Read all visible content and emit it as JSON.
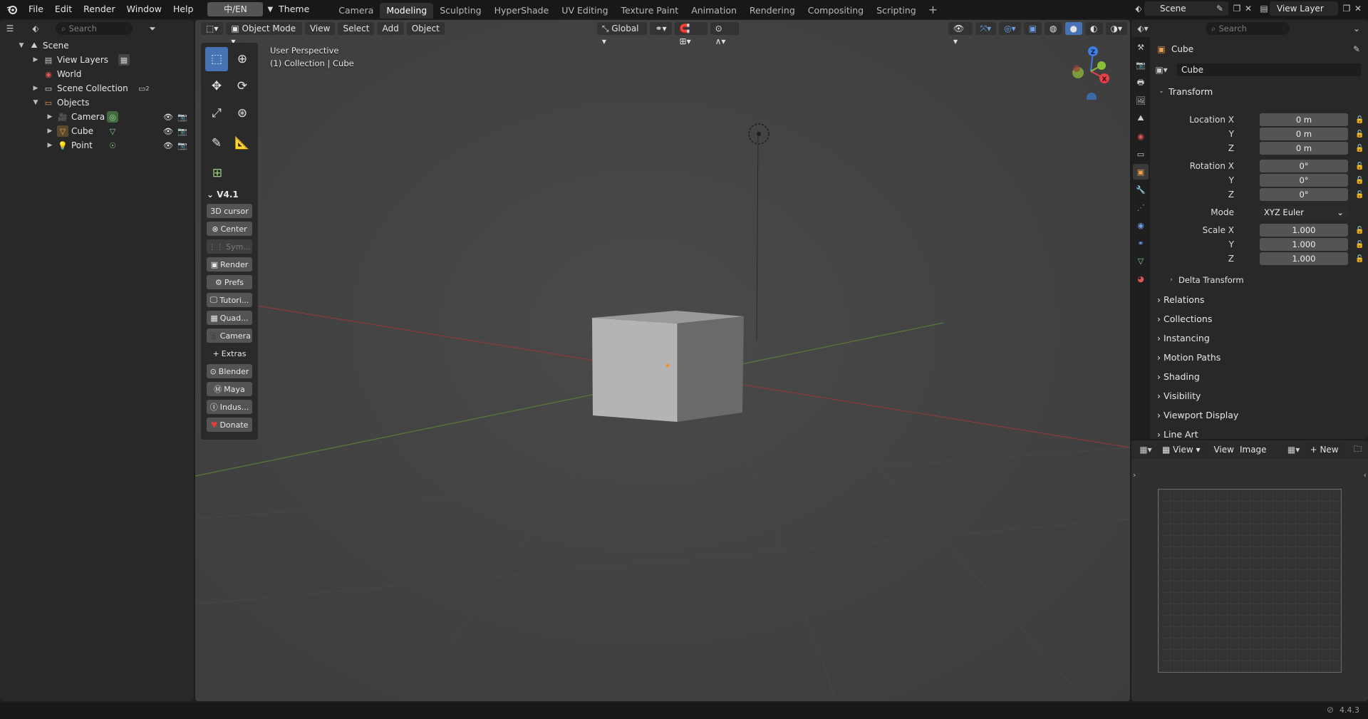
{
  "menu": {
    "items": [
      "File",
      "Edit",
      "Render",
      "Window",
      "Help"
    ],
    "lang_button": "中/EN",
    "theme_label": "Theme"
  },
  "workspaces": {
    "tabs": [
      "Camera",
      "Modeling",
      "Sculpting",
      "HyperShade",
      "UV Editing",
      "Texture Paint",
      "Animation",
      "Rendering",
      "Compositing",
      "Scripting"
    ],
    "active": "Modeling"
  },
  "top_right": {
    "scene": "Scene",
    "view_layer": "View Layer"
  },
  "outliner": {
    "search_placeholder": "Search",
    "rows": {
      "scene": "Scene",
      "view_layers": "View Layers",
      "world": "World",
      "scene_collection": "Scene Collection",
      "scene_collection_badge": "2",
      "objects": "Objects",
      "camera": "Camera",
      "cube": "Cube",
      "point": "Point"
    }
  },
  "viewport": {
    "header": {
      "mode": "Object Mode",
      "view": "View",
      "select": "Select",
      "add": "Add",
      "object": "Object",
      "orientation": "Global"
    },
    "overlay_line1": "User Perspective",
    "overlay_line2": "(1) Collection | Cube",
    "gizmo": {
      "z": "Z",
      "x": "X"
    }
  },
  "v41_panel": {
    "title": "V4.1",
    "buttons": {
      "cursor": "3D cursor",
      "center": "Center",
      "sym": "Sym...",
      "render": "Render",
      "prefs": "Prefs",
      "tutorials": "Tutori...",
      "quad": "Quad...",
      "camera": "Camera",
      "extras": "Extras",
      "blender": "Blender",
      "maya": "Maya",
      "industry": "Indus...",
      "donate": "Donate"
    }
  },
  "properties": {
    "search_placeholder": "Search",
    "object_title": "Cube",
    "object_name": "Cube",
    "transform_title": "Transform",
    "location_label": "Location X",
    "rotation_label": "Rotation X",
    "scale_label": "Scale X",
    "y_label": "Y",
    "z_label": "Z",
    "location": [
      "0 m",
      "0 m",
      "0 m"
    ],
    "rotation": [
      "0°",
      "0°",
      "0°"
    ],
    "mode_label": "Mode",
    "mode_value": "XYZ Euler",
    "scale": [
      "1.000",
      "1.000",
      "1.000"
    ],
    "delta": "Delta Transform",
    "sections": {
      "relations": "Relations",
      "collections": "Collections",
      "instancing": "Instancing",
      "motion_paths": "Motion Paths",
      "shading": "Shading",
      "visibility": "Visibility",
      "viewport_display": "Viewport Display",
      "line_art": "Line Art"
    }
  },
  "image_editor": {
    "view1": "View",
    "view2": "View",
    "image": "Image",
    "new": "New"
  },
  "status": {
    "version": "4.4.3"
  },
  "colors": {
    "accent": "#4772b3",
    "x_axis": "#e5414a",
    "y_axis": "#8bbf3a",
    "z_axis": "#3d7ee0"
  }
}
